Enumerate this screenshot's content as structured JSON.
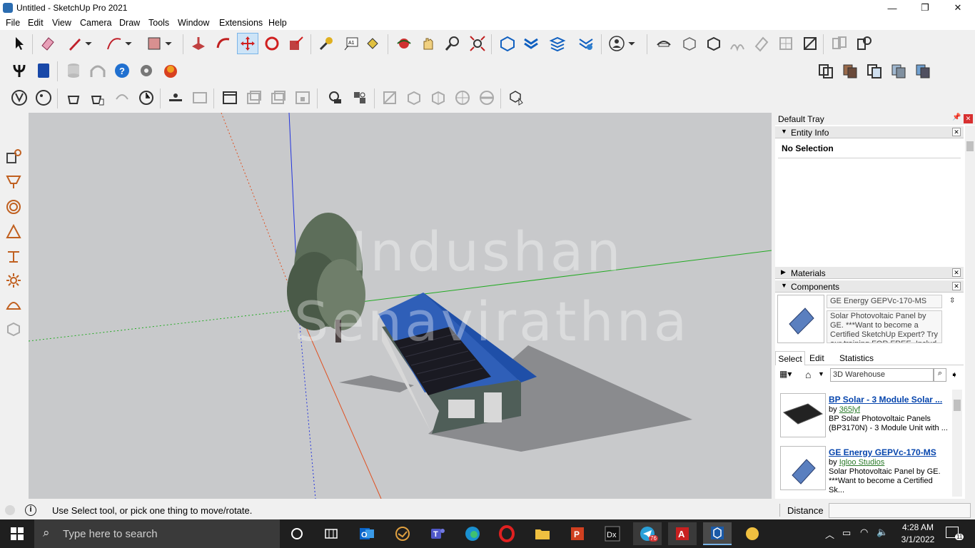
{
  "window": {
    "title": "Untitled - SketchUp Pro 2021",
    "minimize_glyph": "—",
    "maximize_glyph": "❐",
    "close_glyph": "✕"
  },
  "menu": [
    "File",
    "Edit",
    "View",
    "Camera",
    "Draw",
    "Tools",
    "Window",
    "Extensions",
    "Help"
  ],
  "viewport": {
    "watermark_line1": "Indushan",
    "watermark_line2": "Senavirathna"
  },
  "tray": {
    "title": "Default Tray",
    "entity_info": {
      "label": "Entity Info",
      "value": "No Selection"
    },
    "materials": {
      "label": "Materials"
    },
    "components": {
      "label": "Components",
      "selected_name": "GE Energy GEPVc-170-MS",
      "selected_desc": "Solar Photovoltaic Panel by GE. ***Want to become a Certified SketchUp Expert? Try our training FOR FREE. Includ"
    },
    "tabs": [
      "Select",
      "Edit",
      "Statistics"
    ],
    "search_placeholder": "3D Warehouse",
    "results": [
      {
        "title": "BP Solar - 3 Module Solar ...",
        "by": "by",
        "author": "365lyf",
        "desc": "BP Solar Photovoltaic Panels (BP3170N) - 3 Module Unit with ..."
      },
      {
        "title": "GE Energy GEPVc-170-MS",
        "by": "by",
        "author": "Igloo Studios",
        "desc": "Solar Photovoltaic Panel by GE. ***Want to become a Certified Sk..."
      }
    ]
  },
  "status": {
    "message": "Use Select tool, or pick one thing to move/rotate.",
    "measurement_label": "Distance",
    "measurement_value": ""
  },
  "taskbar": {
    "search_placeholder": "Type here to search",
    "time": "4:28 AM",
    "date": "3/1/2022",
    "telegram_badge": "76",
    "notification_badge": "11"
  },
  "colors": {
    "viewport_bg": "#c8c9cb",
    "roof": "#2f5fb8",
    "wall": "#4f5e58",
    "taskbar": "#1f1f1f",
    "link": "#0645ad",
    "axis_blue": "#2233dd",
    "axis_green": "#22aa22",
    "axis_red": "#e05020"
  }
}
